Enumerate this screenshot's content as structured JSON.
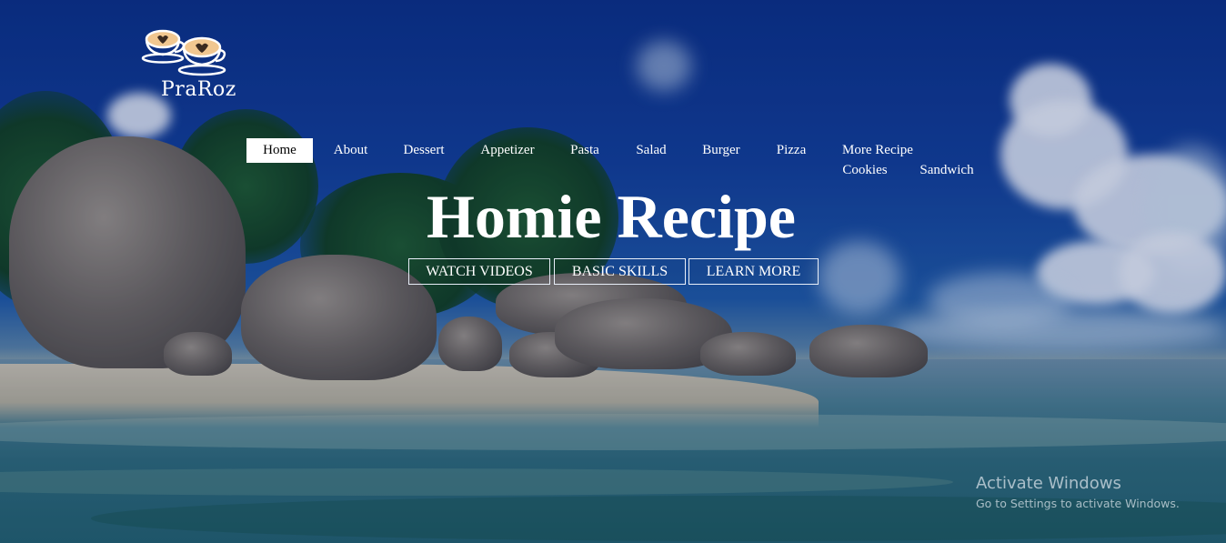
{
  "brand": {
    "name": "PraRoz",
    "logo_icon": "coffee-cups-heart-icon"
  },
  "nav": {
    "items": [
      {
        "label": "Home",
        "active": true
      },
      {
        "label": "About"
      },
      {
        "label": "Dessert"
      },
      {
        "label": "Appetizer"
      },
      {
        "label": "Pasta"
      },
      {
        "label": "Salad"
      },
      {
        "label": "Burger"
      },
      {
        "label": "Pizza"
      },
      {
        "label": "More Recipe"
      },
      {
        "label": "Cookies"
      },
      {
        "label": "Sandwich"
      }
    ]
  },
  "hero": {
    "title": "Homie Recipe",
    "buttons": [
      "WATCH VIDEOS",
      "BASIC SKILLS",
      "LEARN MORE"
    ]
  },
  "watermark": {
    "title": "Activate Windows",
    "subtitle": "Go to Settings to activate Windows."
  },
  "colors": {
    "sky": "#0b2f86",
    "active_nav_bg": "#ffffff",
    "text": "#ffffff"
  }
}
